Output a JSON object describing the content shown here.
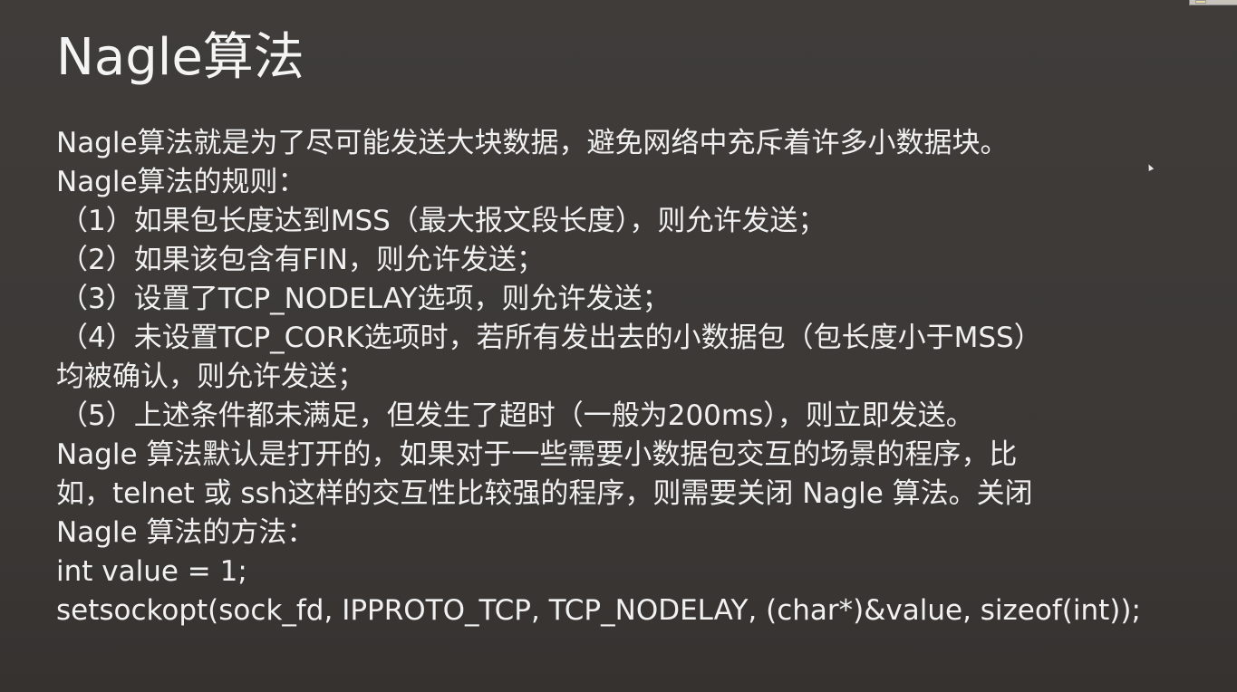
{
  "slide": {
    "title": "Nagle算法",
    "lines": [
      "Nagle算法就是为了尽可能发送大块数据，避免网络中充斥着许多小数据块。",
      "Nagle算法的规则：",
      "（1）如果包长度达到MSS（最大报文段长度），则允许发送；",
      "（2）如果该包含有FIN，则允许发送；",
      "（3）设置了TCP_NODELAY选项，则允许发送；",
      "（4）未设置TCP_CORK选项时，若所有发出去的小数据包（包长度小于MSS）",
      "均被确认，则允许发送；",
      "（5）上述条件都未满足，但发生了超时（一般为200ms），则立即发送。",
      "Nagle 算法默认是打开的，如果对于一些需要小数据包交互的场景的程序，比",
      "如，telnet 或 ssh这样的交互性比较强的程序，则需要关闭 Nagle 算法。关闭",
      "Nagle 算法的方法：",
      "int value = 1;",
      "setsockopt(sock_fd, IPPROTO_TCP, TCP_NODELAY, (char*)&value, sizeof(int));"
    ]
  },
  "colors": {
    "background": "#3d3a38",
    "text": "#f2f2f2"
  },
  "icons": {
    "pointer": "mouse-pointer-icon"
  }
}
